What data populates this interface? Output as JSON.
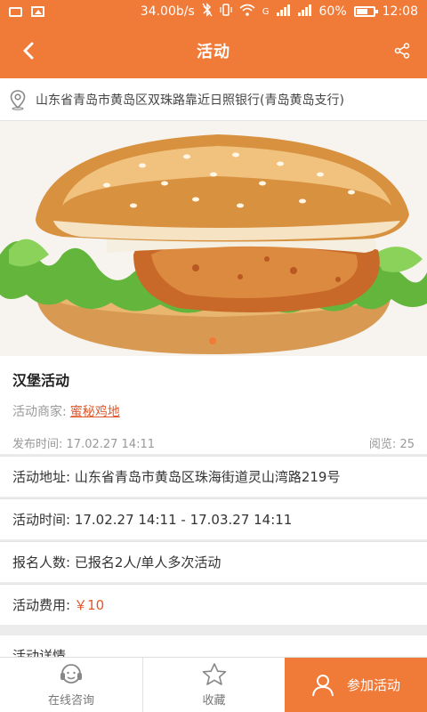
{
  "status_bar": {
    "speed": "34.00b/s",
    "network_label": "G",
    "battery": "60%",
    "time": "12:08"
  },
  "header": {
    "title": "活动"
  },
  "location": {
    "address": "山东省青岛市黄岛区双珠路靠近日照银行(青岛黄岛支行)"
  },
  "event": {
    "title": "汉堡活动",
    "merchant_label": "活动商家:",
    "merchant_name": "蜜秘鸡地",
    "publish_label": "发布时间:",
    "publish_time": "17.02.27 14:11",
    "views_label": "阅览:",
    "views": "25"
  },
  "details": {
    "address": "活动地址: 山东省青岛市黄岛区珠海街道灵山湾路219号",
    "time": "活动时间: 17.02.27 14:11 - 17.03.27 14:11",
    "signup": "报名人数: 已报名2人/单人多次活动",
    "fee_label": "活动费用:",
    "fee_value": "￥10",
    "section_title": "活动详情"
  },
  "bottom_bar": {
    "consult_label": "在线咨询",
    "favorite_label": "收藏",
    "join_label": "参加活动"
  },
  "colors": {
    "accent": "#f07b39",
    "link": "#e2572a"
  },
  "icons": [
    "back-arrow-icon",
    "share-icon",
    "location-pin-icon",
    "headset-icon",
    "star-icon",
    "person-icon"
  ]
}
